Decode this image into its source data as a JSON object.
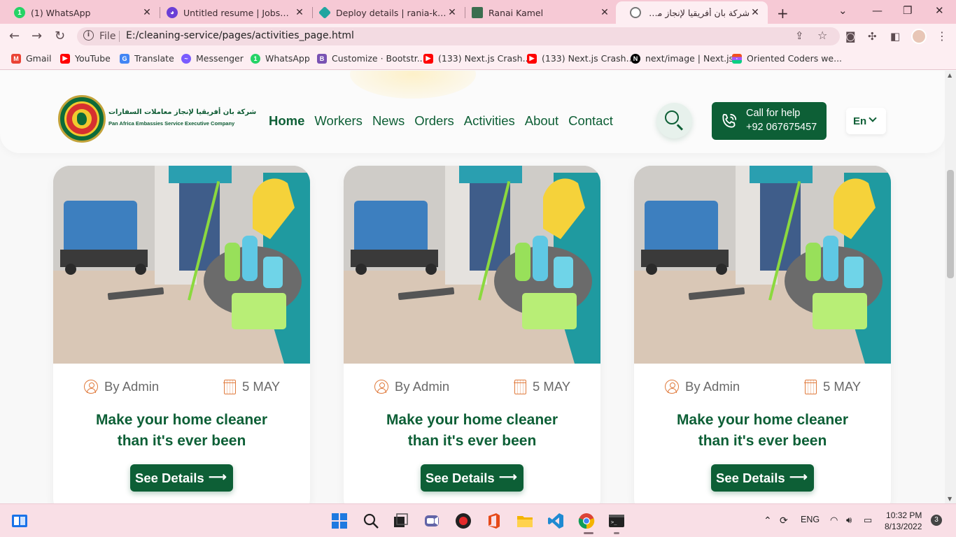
{
  "browser": {
    "tabs": [
      {
        "title": "(1) WhatsApp",
        "favicon": "whatsapp-icon",
        "color": "#25d366"
      },
      {
        "title": "Untitled resume | Jobseeker",
        "favicon": "jobseeker-icon",
        "color": "#6b3fd6"
      },
      {
        "title": "Deploy details | rania-kamel-",
        "favicon": "netlify-icon",
        "color": "#20a5a0"
      },
      {
        "title": "Ranai Kamel",
        "favicon": "portfolio-icon",
        "color": "#3b6e4f"
      },
      {
        "title": "شركة بان أفريقيا لإنجاز معاملات",
        "favicon": "globe-icon",
        "color": "#777777"
      }
    ],
    "address": {
      "scheme": "File",
      "url": "E:/cleaning-service/pages/activities_page.html"
    },
    "bookmarks": [
      {
        "label": "Gmail",
        "icon": "gmail-icon",
        "color": "#ea4335"
      },
      {
        "label": "YouTube",
        "icon": "youtube-icon",
        "color": "#ff0000"
      },
      {
        "label": "Translate",
        "icon": "translate-icon",
        "color": "#4285f4"
      },
      {
        "label": "Messenger",
        "icon": "messenger-icon",
        "color": "#7a5cff"
      },
      {
        "label": "WhatsApp",
        "icon": "whatsapp-icon",
        "color": "#25d366"
      },
      {
        "label": "Customize · Bootstr...",
        "icon": "bootstrap-icon",
        "color": "#7952b3"
      },
      {
        "label": "(133) Next.js Crash...",
        "icon": "youtube-icon",
        "color": "#ff0000"
      },
      {
        "label": "(133) Next.js Crash...",
        "icon": "youtube-icon",
        "color": "#ff0000"
      },
      {
        "label": "next/image | Next.js",
        "icon": "nextjs-icon",
        "color": "#000000"
      },
      {
        "label": "Oriented Coders we...",
        "icon": "figma-icon",
        "color": "#f24e1e"
      }
    ]
  },
  "site": {
    "brand": {
      "name_ar": "شركة بان أفريقيا لإنجاز معاملات السفارات",
      "name_en": "Pan Africa Embassies Service Executive Company"
    },
    "nav": [
      {
        "label": "Home",
        "active": true
      },
      {
        "label": "Workers",
        "active": false
      },
      {
        "label": "News",
        "active": false
      },
      {
        "label": "Orders",
        "active": false
      },
      {
        "label": "Activities",
        "active": false
      },
      {
        "label": "About",
        "active": false
      },
      {
        "label": "Contact",
        "active": false
      }
    ],
    "call": {
      "label": "Call for help",
      "phone": "+92 067675457"
    },
    "language": "En",
    "colors": {
      "primary": "#0d5f36",
      "accent": "#e07a3c"
    },
    "cards": [
      {
        "author": "By Admin",
        "date": "5 MAY",
        "title_line1": "Make your home cleaner",
        "title_line2": "than it's ever been",
        "button": "See Details",
        "arrow": "⟶"
      },
      {
        "author": "By Admin",
        "date": "5 MAY",
        "title_line1": "Make your home cleaner",
        "title_line2": "than it's ever been",
        "button": "See Details",
        "arrow": "⟶"
      },
      {
        "author": "By Admin",
        "date": "5 MAY",
        "title_line1": "Make your home cleaner",
        "title_line2": "than it's ever been",
        "button": "See Details",
        "arrow": "⟶"
      }
    ]
  },
  "taskbar": {
    "apps": [
      "start-icon",
      "search-icon",
      "task-view-icon",
      "teams-icon",
      "record-icon",
      "office-icon",
      "file-explorer-icon",
      "vscode-icon",
      "chrome-icon",
      "terminal-icon"
    ],
    "language": "ENG",
    "time": "10:32 PM",
    "date": "8/13/2022",
    "notifications": "3"
  }
}
